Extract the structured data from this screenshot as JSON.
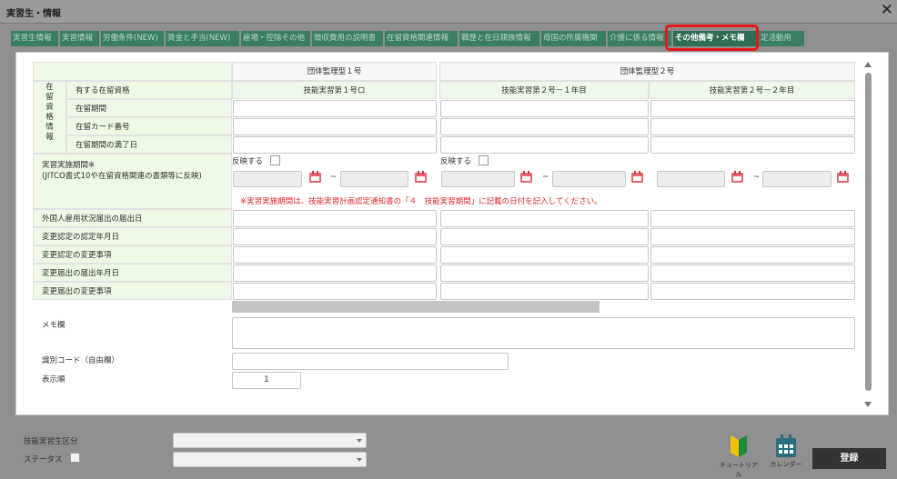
{
  "window": {
    "title": "実習生・情報",
    "close_glyph": "✕"
  },
  "tabs": [
    {
      "label": "実習生情報",
      "active": false
    },
    {
      "label": "実習情報",
      "active": false
    },
    {
      "label": "労働条件(NEW)",
      "active": false
    },
    {
      "label": "賃金と手当(NEW)",
      "active": false
    },
    {
      "label": "雇場・控除その他",
      "active": false
    },
    {
      "label": "徴収費用の説明書",
      "active": false
    },
    {
      "label": "在留資格関連情報",
      "active": false
    },
    {
      "label": "職歴と在日親族情報",
      "active": false
    },
    {
      "label": "母国の所属機関",
      "active": false
    },
    {
      "label": "介護に係る情報",
      "active": false
    },
    {
      "label": "その他備考・メモ欄",
      "active": true
    },
    {
      "label": "定活動用",
      "active": false
    }
  ],
  "table": {
    "group1": "団体監理型１号",
    "group2": "団体監理型２号",
    "section_label": [
      "在",
      "留",
      "資",
      "格",
      "情",
      "報"
    ],
    "qualification_label": "有する在留資格",
    "qualifications": [
      "技能実習第１号ロ",
      "技能実習第２号－１年目",
      "技能実習第２号－２年目"
    ],
    "rows": [
      "在留期間",
      "在留カード番号",
      "在留期間の満了日"
    ],
    "period_label": [
      "実習実施期間※",
      "(JITCO書式10や在留資格関連の書類等に反映)"
    ],
    "reflect_label": "反映する",
    "tilde": "~",
    "period_note": "※実習実施期間は、技能実習計画認定通知書の「４　技能実習期間」に記載の日付を記入してください。",
    "lower_rows": [
      "外国人雇用状況届出の届出日",
      "変更認定の認定年月日",
      "変更認定の変更事項",
      "変更届出の届出年月日",
      "変更届出の変更事項"
    ]
  },
  "memo": {
    "label": "メモ欄",
    "value": ""
  },
  "id_code": {
    "label": "識別コード（自由欄）",
    "value": ""
  },
  "display_order": {
    "label": "表示順",
    "value": "1"
  },
  "bottom": {
    "category_label": "技能実習生区分",
    "status_label": "ステータス",
    "tutorial": "チュートリアル",
    "calendar": "カレンダー",
    "register": "登録"
  },
  "colors": {
    "tab": "#3a7e64",
    "active_tab": "#2f6e55",
    "highlight": "#e8161b",
    "label_bg": "#eef8e6",
    "note": "#e0262b"
  }
}
